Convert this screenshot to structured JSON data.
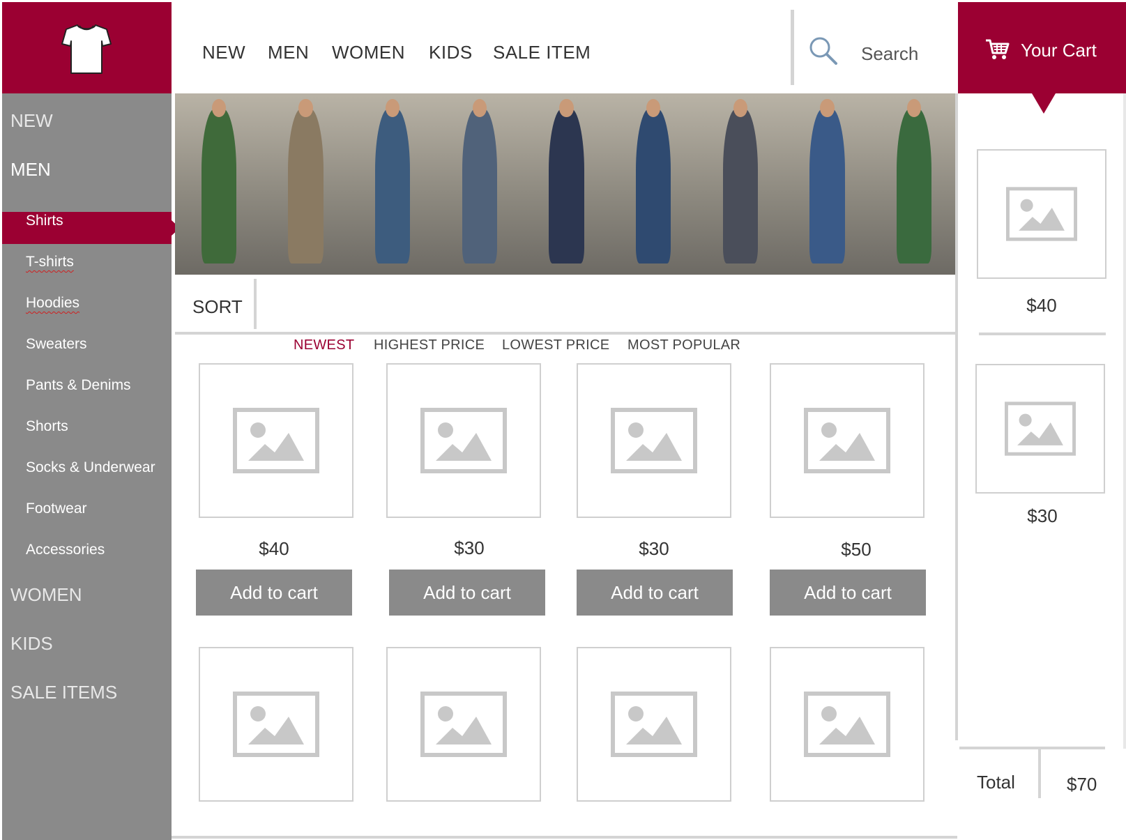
{
  "header": {
    "nav": [
      "NEW",
      "MEN",
      "WOMEN",
      "KIDS",
      "SALE ITEM"
    ],
    "search_placeholder": "Search",
    "cart_label": "Your Cart"
  },
  "sidebar": {
    "top_items": [
      "NEW",
      "MEN",
      "WOMEN",
      "KIDS",
      "SALE ITEMS"
    ],
    "active_top": "MEN",
    "subcategories": [
      "Shirts",
      "T-shirts",
      "Hoodies",
      "Sweaters",
      "Pants & Denims",
      "Shorts",
      "Socks & Underwear",
      "Footwear",
      "Accessories"
    ],
    "active_sub": "Shirts"
  },
  "banner": {
    "panels": [
      "#3f6a3a",
      "#8a7a62",
      "#3d5c7e",
      "#50627a",
      "#2c3650",
      "#2f4a70",
      "#4a4e5a",
      "#3a5a88",
      "#3a6a3e"
    ]
  },
  "sort": {
    "label": "SORT",
    "options": [
      "NEWEST",
      "HIGHEST PRICE",
      "LOWEST PRICE",
      "MOST POPULAR"
    ],
    "active": "NEWEST"
  },
  "products": [
    {
      "price": "$40",
      "button": "Add to cart"
    },
    {
      "price": "$30",
      "button": "Add to cart"
    },
    {
      "price": "$30",
      "button": "Add to cart"
    },
    {
      "price": "$50",
      "button": "Add to cart"
    }
  ],
  "cart": {
    "items": [
      {
        "price": "$40"
      },
      {
        "price": "$30"
      }
    ],
    "total_label": "Total",
    "total_value": "$70"
  },
  "colors": {
    "accent": "#9b0032",
    "sidebar": "#8a8a8a",
    "placeholder": "#c8c8c8"
  }
}
